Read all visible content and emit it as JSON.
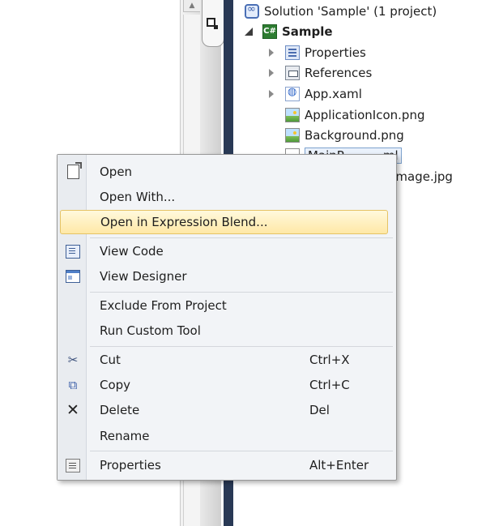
{
  "solution_explorer": {
    "solution_label": "Solution 'Sample' (1 project)",
    "project_label": "Sample",
    "project_badge": "C#",
    "items": [
      {
        "label": "Properties",
        "icon": "properties-icon"
      },
      {
        "label": "References",
        "icon": "references-icon"
      },
      {
        "label": "App.xaml",
        "icon": "xaml-icon"
      },
      {
        "label": "ApplicationIcon.png",
        "icon": "image-icon"
      },
      {
        "label": "Background.png",
        "icon": "image-icon"
      },
      {
        "label": "MainPage.xaml",
        "icon": "xaml-icon",
        "selected": true
      },
      {
        "label": "SplashScreenImage.jpg",
        "icon": "image-icon"
      }
    ],
    "visible_fragments": {
      "selected_prefix": "MainP",
      "selected_suffix": "ml",
      "hidden_item_suffix": "Image.jpg"
    }
  },
  "context_menu": {
    "items": [
      {
        "label": "Open",
        "icon": "open-icon",
        "shortcut": ""
      },
      {
        "label": "Open With...",
        "icon": "",
        "shortcut": ""
      },
      {
        "label": "Open in Expression Blend...",
        "icon": "",
        "shortcut": "",
        "highlighted": true
      },
      {
        "label": "View Code",
        "icon": "view-code-icon",
        "shortcut": ""
      },
      {
        "label": "View Designer",
        "icon": "view-designer-icon",
        "shortcut": ""
      },
      {
        "label": "Exclude From Project",
        "icon": "",
        "shortcut": ""
      },
      {
        "label": "Run Custom Tool",
        "icon": "",
        "shortcut": ""
      },
      {
        "label": "Cut",
        "icon": "cut-icon",
        "shortcut": "Ctrl+X"
      },
      {
        "label": "Copy",
        "icon": "copy-icon",
        "shortcut": "Ctrl+C"
      },
      {
        "label": "Delete",
        "icon": "delete-icon",
        "shortcut": "Del"
      },
      {
        "label": "Rename",
        "icon": "",
        "shortcut": ""
      },
      {
        "label": "Properties",
        "icon": "properties-icon",
        "shortcut": "Alt+Enter"
      }
    ]
  },
  "colors": {
    "highlight_fill": "#ffe8a6",
    "highlight_border": "#e5c365",
    "menu_background": "#f2f4f7",
    "divider_dark": "#293955",
    "selection_border": "#7da2ce"
  }
}
